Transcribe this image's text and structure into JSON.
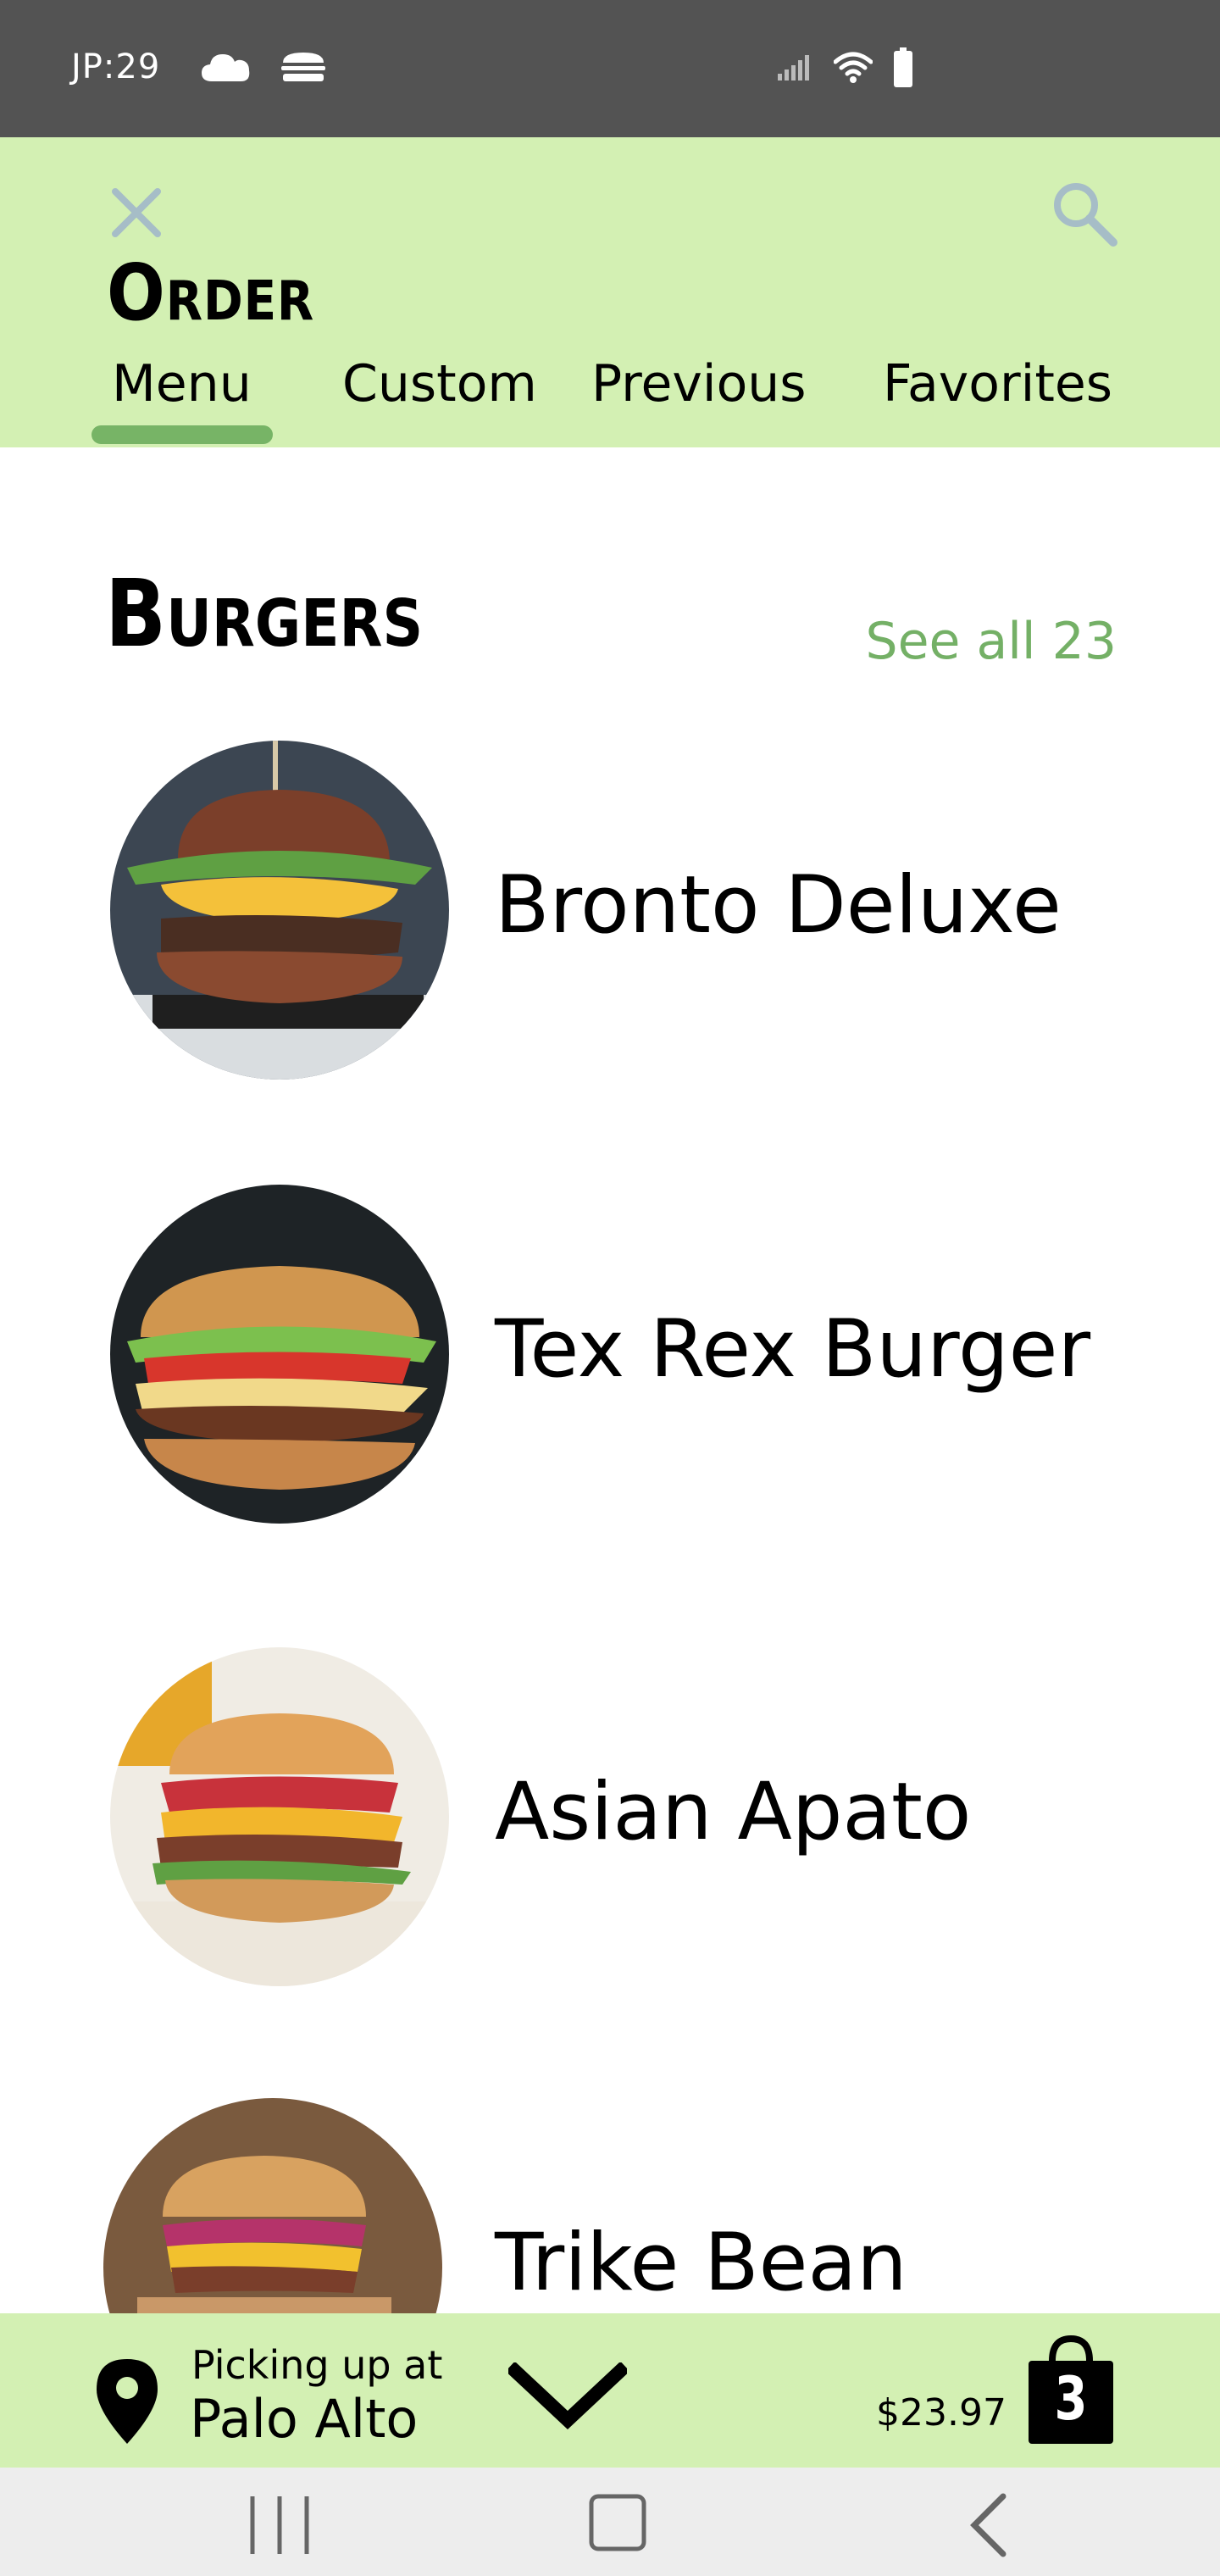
{
  "status_bar": {
    "time": "JP:29",
    "left_icons": [
      "cloud-icon",
      "burger-status-icon"
    ],
    "right_icons": [
      "signal-icon",
      "wifi-icon",
      "battery-icon"
    ]
  },
  "header": {
    "title": "Order",
    "tabs": [
      {
        "label": "Menu",
        "active": true
      },
      {
        "label": "Custom",
        "active": false
      },
      {
        "label": "Previous",
        "active": false
      },
      {
        "label": "Favorites",
        "active": false
      }
    ],
    "close_icon": "close-icon",
    "search_icon": "search-icon"
  },
  "section": {
    "title": "Burgers",
    "see_all": "See all 23"
  },
  "items": [
    {
      "name": "Bronto Deluxe"
    },
    {
      "name": "Tex Rex Burger"
    },
    {
      "name": "Asian Apato"
    },
    {
      "name": "Trike Bean"
    }
  ],
  "bottom_bar": {
    "pickup_label": "Picking up at",
    "pickup_location": "Palo Alto",
    "cart_total": "$23.97",
    "cart_count": "3"
  },
  "nav_bar": {
    "buttons": [
      "recents-icon",
      "home-icon",
      "back-icon"
    ]
  },
  "colors": {
    "accent": "#d3f0b3",
    "accent_dark": "#77b466",
    "status_bar": "#535353"
  }
}
